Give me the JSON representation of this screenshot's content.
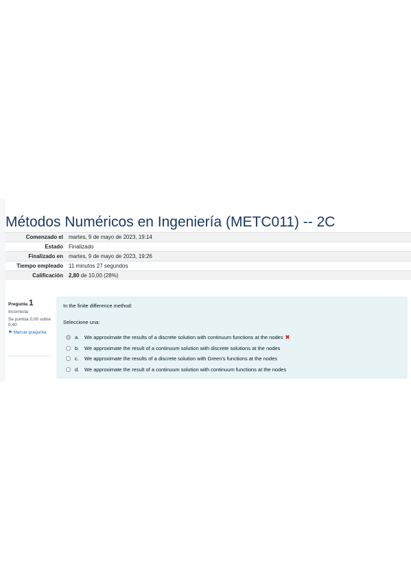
{
  "course": {
    "title": "Métodos Numéricos en Ingeniería (METC011) -- 2C"
  },
  "summary": {
    "rows": [
      {
        "label": "Comenzado el",
        "value": "martes, 9 de mayo de 2023, 19:14"
      },
      {
        "label": "Estado",
        "value": "Finalizado"
      },
      {
        "label": "Finalizado en",
        "value": "martes, 9 de mayo de 2023, 19:26"
      },
      {
        "label": "Tiempo empleado",
        "value": "11 minutos 27 segundos"
      },
      {
        "label": "Calificación",
        "value_bold": "2,80",
        "value_rest": " de 10,00 (28%)"
      }
    ]
  },
  "question": {
    "number_label": "Pregunta",
    "number": "1",
    "state": "Incorrecta",
    "mark": "Se puntúa 0,00 sobre 0,40",
    "flag_label": "Marcar pregunta",
    "flag_icon": "flag-icon",
    "text": "In the finite difference method:",
    "prompt": "Seleccione una:",
    "answers": [
      {
        "letter": "a.",
        "text": "We approximate the results of a discrete solution with continuum functions at the nodes",
        "selected": true,
        "incorrect": true,
        "mark_icon": "cross-icon"
      },
      {
        "letter": "b.",
        "text": "We approximate the result of a continuum solution with discrete solutions at the nodes",
        "selected": false
      },
      {
        "letter": "c.",
        "text": "We approximate the results of a discrete solution with Green's functions at the nodes",
        "selected": false
      },
      {
        "letter": "d.",
        "text": "We approximate the result of a continuum solution with continuum functions at the nodes",
        "selected": false
      }
    ]
  },
  "colors": {
    "title": "#1a3866",
    "question_bg": "#e7f3f5",
    "incorrect": "#ca3120",
    "link": "#0f6cbf"
  }
}
